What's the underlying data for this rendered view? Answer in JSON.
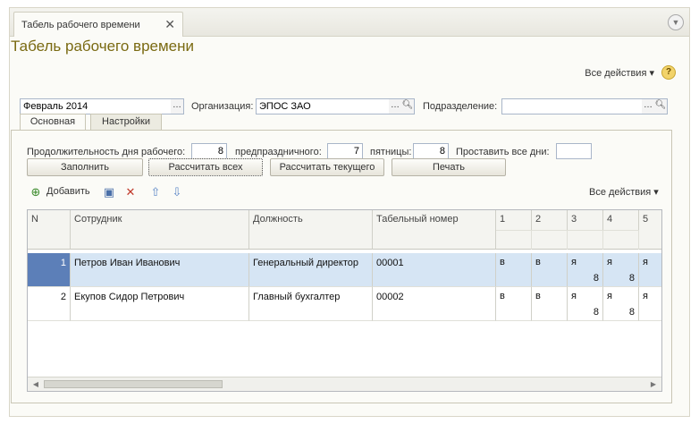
{
  "tab": {
    "label": "Табель рабочего времени",
    "close": "✕"
  },
  "page": {
    "title": "Табель рабочего времени"
  },
  "top_actions": {
    "all_actions": "Все действия ▾",
    "help": "?"
  },
  "filters": {
    "period": "Февраль 2014",
    "org_label": "Организация:",
    "org_value": "ЭПОС ЗАО",
    "dept_label": "Подразделение:",
    "dept_value": ""
  },
  "subtabs": [
    "Основная",
    "Настройки"
  ],
  "duration": {
    "workday_label": "Продолжительность дня рабочего:",
    "workday_value": "8",
    "preholiday_label": "предпраздничного:",
    "preholiday_value": "7",
    "friday_label": "пятницы:",
    "friday_value": "8",
    "all_days_label": "Проставить все дни:",
    "all_days_value": ""
  },
  "buttons": {
    "fill": "Заполнить",
    "calc_all": "Рассчитать всех",
    "calc_current": "Рассчитать текущего",
    "print": "Печать"
  },
  "toolbar": {
    "add": "Добавить",
    "all_actions": "Все действия ▾"
  },
  "table": {
    "headers": [
      "N",
      "Сотрудник",
      "Должность",
      "Табельный номер",
      "1",
      "2",
      "3",
      "4",
      "5"
    ],
    "rows": [
      {
        "n": "1",
        "employee": "Петров Иван Иванович",
        "position": "Генеральный директор",
        "tab_number": "00001",
        "days": [
          {
            "code": "в",
            "hours": ""
          },
          {
            "code": "в",
            "hours": ""
          },
          {
            "code": "я",
            "hours": "8"
          },
          {
            "code": "я",
            "hours": "8"
          },
          {
            "code": "я",
            "hours": ""
          }
        ]
      },
      {
        "n": "2",
        "employee": "Екупов Сидор Петрович",
        "position": "Главный бухгалтер",
        "tab_number": "00002",
        "days": [
          {
            "code": "в",
            "hours": ""
          },
          {
            "code": "в",
            "hours": ""
          },
          {
            "code": "я",
            "hours": "8"
          },
          {
            "code": "я",
            "hours": "8"
          },
          {
            "code": "я",
            "hours": ""
          }
        ]
      }
    ]
  },
  "colors": {
    "title": "#7a6a12",
    "selected_row": "#d6e5f4",
    "row_number_highlight": "#5c7fb8"
  }
}
